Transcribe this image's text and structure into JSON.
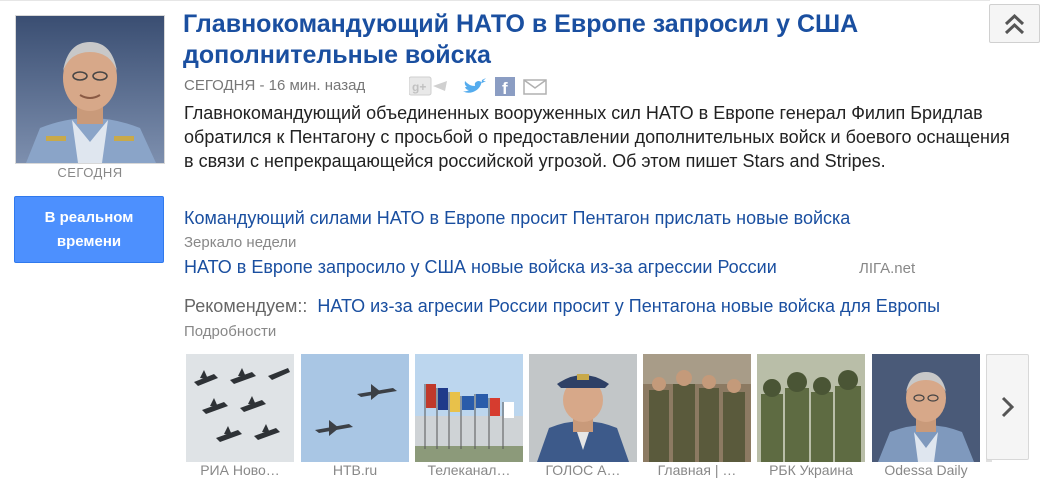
{
  "story": {
    "headline": "Главнокомандующий НАТО в Европе запросил у США дополнительные войска",
    "time": "СЕГОДНЯ - 16 мин. назад",
    "snippet": "Главнокомандующий объединенных вооруженных сил НАТО в Европе генерал Филип Бридлав обратился к Пентагону с просьбой о предоставлении дополнительных войск и боевого оснащения в связи с непрекращающейся российской угрозой. Об этом пишет Stars and Stripes.",
    "thumb_caption": "СЕГОДНЯ"
  },
  "realtime_button": "В реальном времени",
  "share_icons": [
    "google-plus-icon",
    "twitter-icon",
    "facebook-icon",
    "mail-icon"
  ],
  "related": [
    {
      "title": "Командующий силами НАТО в Европе просит Пентагон прислать новые войска",
      "source": "Зеркало недели"
    },
    {
      "title": "НАТО в Европе запросило у США новые войска из-за агрессии России",
      "source": "ЛІГА.net"
    }
  ],
  "recommended": {
    "label": "Рекомендуем::",
    "title": "НАТО из-за агресии России просит у Пентагона новые войска для Европы",
    "source": "Подробности"
  },
  "image_strip": [
    "РИА Ново…",
    "НТВ.ru",
    "Телеканал…",
    "ГОЛОС А…",
    "Главная | …",
    "РБК Украина",
    "Odessa Daily"
  ],
  "colors": {
    "link": "#1a4fa0",
    "button": "#4d90fe",
    "meta": "#777777"
  }
}
